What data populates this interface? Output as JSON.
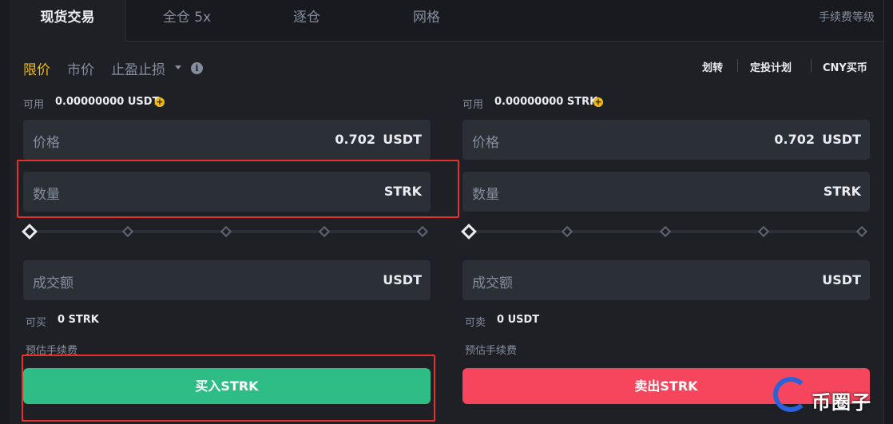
{
  "tabs": [
    {
      "label": "现货交易",
      "active": true
    },
    {
      "label": "全仓 5x",
      "active": false
    },
    {
      "label": "逐仓",
      "active": false
    },
    {
      "label": "网格",
      "active": false
    }
  ],
  "fee_level_label": "手续费等级",
  "order_types": [
    {
      "label": "限价",
      "active": true
    },
    {
      "label": "市价",
      "active": false
    },
    {
      "label": "止盈止损",
      "active": false
    }
  ],
  "info_icon_glyph": "i",
  "top_links": [
    "划转",
    "定投计划",
    "CNY买币"
  ],
  "buy": {
    "available_label": "可用",
    "available_value": "0.00000000 USDT",
    "price_label": "价格",
    "price_value": "0.702",
    "price_unit": "USDT",
    "amount_label": "数量",
    "amount_unit": "STRK",
    "total_label": "成交额",
    "total_unit": "USDT",
    "max_label": "可买",
    "max_value": "0 STRK",
    "fee_label": "预估手续费",
    "button_label": "买入STRK",
    "slider_position": 0
  },
  "sell": {
    "available_label": "可用",
    "available_value": "0.00000000 STRK",
    "price_label": "价格",
    "price_value": "0.702",
    "price_unit": "USDT",
    "amount_label": "数量",
    "amount_unit": "STRK",
    "total_label": "成交额",
    "total_unit": "USDT",
    "max_label": "可卖",
    "max_value": "0 USDT",
    "fee_label": "预估手续费",
    "button_label": "卖出STRK",
    "slider_position": 0
  },
  "watermark": "币圈子",
  "colors": {
    "accent": "#f0b90b",
    "buy": "#2ebd85",
    "sell": "#f6465d",
    "highlight_box": "#e5312a",
    "background": "#1e2026",
    "field": "#2b2f36"
  }
}
